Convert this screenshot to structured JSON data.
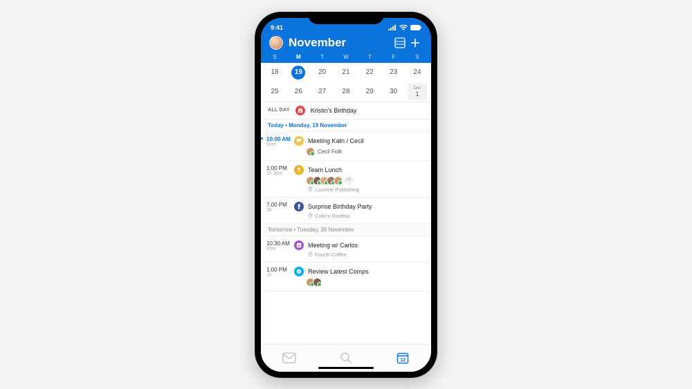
{
  "status": {
    "time": "9:41"
  },
  "header": {
    "month": "November",
    "weekdays": [
      "S",
      "M",
      "T",
      "W",
      "T",
      "F",
      "S"
    ],
    "today_weekday_index": 1
  },
  "calendar": {
    "rows": [
      [
        "18",
        "19",
        "20",
        "21",
        "22",
        "23",
        "24"
      ],
      [
        "25",
        "26",
        "27",
        "28",
        "29",
        "30",
        "1"
      ]
    ],
    "selected_day": "19",
    "next_month_label": "Dec"
  },
  "allday": {
    "label": "ALL DAY",
    "events": [
      {
        "title": "Kristin's Birthday"
      }
    ]
  },
  "sections": [
    {
      "key": "today",
      "label": "Today • Monday, 19 November",
      "is_today": true,
      "events": [
        {
          "time": "10:00 AM",
          "duration": "30m",
          "title": "Meeting Katri / Cecil",
          "icon": "chat-icon",
          "color": "yellow",
          "current": true,
          "attendees": [
            {
              "name": "Cecil Folk"
            }
          ],
          "show_first_name": true
        },
        {
          "time": "1:00 PM",
          "duration": "1h 30m",
          "title": "Team Lunch",
          "icon": "fork-icon",
          "color": "gold",
          "attendees": [
            {},
            {},
            {},
            {},
            {}
          ],
          "attendees_overflow": "+7",
          "location": "Lucerne Publishing"
        },
        {
          "time": "7:00 PM",
          "duration": "3h",
          "title": "Surprise Birthday Party",
          "icon": "facebook-icon",
          "color": "fb",
          "location": "Colin's Rooftop"
        }
      ]
    },
    {
      "key": "tomorrow",
      "label": "Tomorrow • Tuesday, 20 November",
      "is_today": false,
      "events": [
        {
          "time": "10:30 AM",
          "duration": "45m",
          "title": "Meeting w/ Carlos",
          "icon": "onenote-icon",
          "color": "purple",
          "location": "Fourth Coffee"
        },
        {
          "time": "1:00 PM",
          "duration": "1h",
          "title": "Review Latest Comps",
          "icon": "skype-icon",
          "color": "skype",
          "attendees": [
            {},
            {}
          ]
        }
      ]
    }
  ],
  "tabbar": {
    "active": "calendar",
    "calendar_badge": "12"
  }
}
